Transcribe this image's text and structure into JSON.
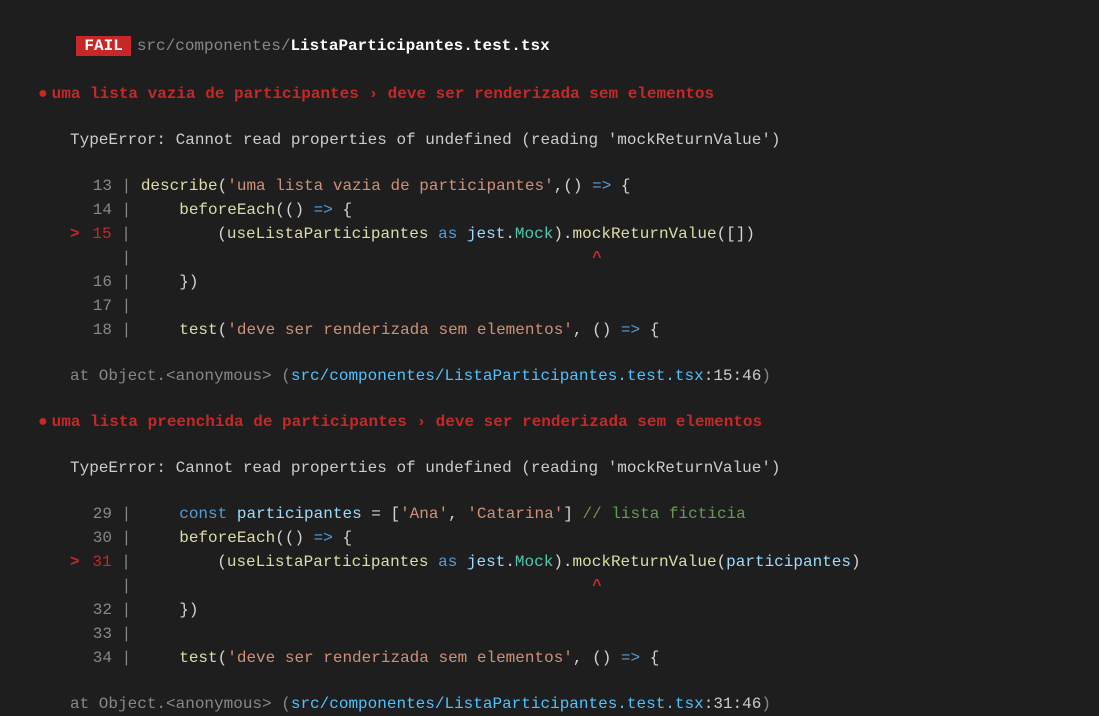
{
  "fail_label": "FAIL",
  "file_path_prefix": "src/componentes/",
  "file_name": "ListaParticipantes.test.tsx",
  "tests": [
    {
      "title": "uma lista vazia de participantes › deve ser renderizada sem elementos",
      "error": "TypeError: Cannot read properties of undefined (reading 'mockReturnValue')",
      "code_lines": [
        {
          "num": "13",
          "active": false,
          "segments": [
            {
              "cls": "kw-yellow",
              "text": "describe"
            },
            {
              "cls": "kw-white",
              "text": "("
            },
            {
              "cls": "kw-orange",
              "text": "'uma lista vazia de participantes'"
            },
            {
              "cls": "kw-white",
              "text": ",() "
            },
            {
              "cls": "kw-blue",
              "text": "=>"
            },
            {
              "cls": "kw-white",
              "text": " {"
            }
          ]
        },
        {
          "num": "14",
          "active": false,
          "segments": [
            {
              "cls": "kw-white",
              "text": "    "
            },
            {
              "cls": "kw-yellow",
              "text": "beforeEach"
            },
            {
              "cls": "kw-white",
              "text": "(() "
            },
            {
              "cls": "kw-blue",
              "text": "=>"
            },
            {
              "cls": "kw-white",
              "text": " {"
            }
          ]
        },
        {
          "num": "15",
          "active": true,
          "segments": [
            {
              "cls": "kw-white",
              "text": "        ("
            },
            {
              "cls": "kw-yellow",
              "text": "useListaParticipantes"
            },
            {
              "cls": "kw-white",
              "text": " "
            },
            {
              "cls": "kw-blue",
              "text": "as"
            },
            {
              "cls": "kw-white",
              "text": " "
            },
            {
              "cls": "kw-lightblue",
              "text": "jest"
            },
            {
              "cls": "kw-white",
              "text": "."
            },
            {
              "cls": "kw-green",
              "text": "Mock"
            },
            {
              "cls": "kw-white",
              "text": ")."
            },
            {
              "cls": "kw-yellow",
              "text": "mockReturnValue"
            },
            {
              "cls": "kw-white",
              "text": "([])"
            }
          ]
        },
        {
          "num": "",
          "active": false,
          "caret": "                                               ^"
        },
        {
          "num": "16",
          "active": false,
          "segments": [
            {
              "cls": "kw-white",
              "text": "    })"
            }
          ]
        },
        {
          "num": "17",
          "active": false,
          "segments": []
        },
        {
          "num": "18",
          "active": false,
          "segments": [
            {
              "cls": "kw-white",
              "text": "    "
            },
            {
              "cls": "kw-yellow",
              "text": "test"
            },
            {
              "cls": "kw-white",
              "text": "("
            },
            {
              "cls": "kw-orange",
              "text": "'deve ser renderizada sem elementos'"
            },
            {
              "cls": "kw-white",
              "text": ", () "
            },
            {
              "cls": "kw-blue",
              "text": "=>"
            },
            {
              "cls": "kw-white",
              "text": " {"
            }
          ]
        }
      ],
      "stack_prefix": "at Object.<anonymous> (",
      "stack_file": "src/componentes/ListaParticipantes.test.tsx",
      "stack_loc": ":15:46",
      "stack_suffix": ")"
    },
    {
      "title": "uma lista preenchida de participantes › deve ser renderizada sem elementos",
      "error": "TypeError: Cannot read properties of undefined (reading 'mockReturnValue')",
      "code_lines": [
        {
          "num": "29",
          "active": false,
          "segments": [
            {
              "cls": "kw-white",
              "text": "    "
            },
            {
              "cls": "kw-blue",
              "text": "const"
            },
            {
              "cls": "kw-white",
              "text": " "
            },
            {
              "cls": "kw-lightblue",
              "text": "participantes"
            },
            {
              "cls": "kw-white",
              "text": " = ["
            },
            {
              "cls": "kw-orange",
              "text": "'Ana'"
            },
            {
              "cls": "kw-white",
              "text": ", "
            },
            {
              "cls": "kw-orange",
              "text": "'Catarina'"
            },
            {
              "cls": "kw-white",
              "text": "] "
            },
            {
              "cls": "kw-comment",
              "text": "// lista ficticia"
            }
          ]
        },
        {
          "num": "30",
          "active": false,
          "segments": [
            {
              "cls": "kw-white",
              "text": "    "
            },
            {
              "cls": "kw-yellow",
              "text": "beforeEach"
            },
            {
              "cls": "kw-white",
              "text": "(() "
            },
            {
              "cls": "kw-blue",
              "text": "=>"
            },
            {
              "cls": "kw-white",
              "text": " {"
            }
          ]
        },
        {
          "num": "31",
          "active": true,
          "segments": [
            {
              "cls": "kw-white",
              "text": "        ("
            },
            {
              "cls": "kw-yellow",
              "text": "useListaParticipantes"
            },
            {
              "cls": "kw-white",
              "text": " "
            },
            {
              "cls": "kw-blue",
              "text": "as"
            },
            {
              "cls": "kw-white",
              "text": " "
            },
            {
              "cls": "kw-lightblue",
              "text": "jest"
            },
            {
              "cls": "kw-white",
              "text": "."
            },
            {
              "cls": "kw-green",
              "text": "Mock"
            },
            {
              "cls": "kw-white",
              "text": ")."
            },
            {
              "cls": "kw-yellow",
              "text": "mockReturnValue"
            },
            {
              "cls": "kw-white",
              "text": "("
            },
            {
              "cls": "kw-lightblue",
              "text": "participantes"
            },
            {
              "cls": "kw-white",
              "text": ")"
            }
          ]
        },
        {
          "num": "",
          "active": false,
          "caret": "                                               ^"
        },
        {
          "num": "32",
          "active": false,
          "segments": [
            {
              "cls": "kw-white",
              "text": "    })"
            }
          ]
        },
        {
          "num": "33",
          "active": false,
          "segments": []
        },
        {
          "num": "34",
          "active": false,
          "segments": [
            {
              "cls": "kw-white",
              "text": "    "
            },
            {
              "cls": "kw-yellow",
              "text": "test"
            },
            {
              "cls": "kw-white",
              "text": "("
            },
            {
              "cls": "kw-orange",
              "text": "'deve ser renderizada sem elementos'"
            },
            {
              "cls": "kw-white",
              "text": ", () "
            },
            {
              "cls": "kw-blue",
              "text": "=>"
            },
            {
              "cls": "kw-white",
              "text": " {"
            }
          ]
        }
      ],
      "stack_prefix": "at Object.<anonymous> (",
      "stack_file": "src/componentes/ListaParticipantes.test.tsx",
      "stack_loc": ":31:46",
      "stack_suffix": ")"
    }
  ]
}
